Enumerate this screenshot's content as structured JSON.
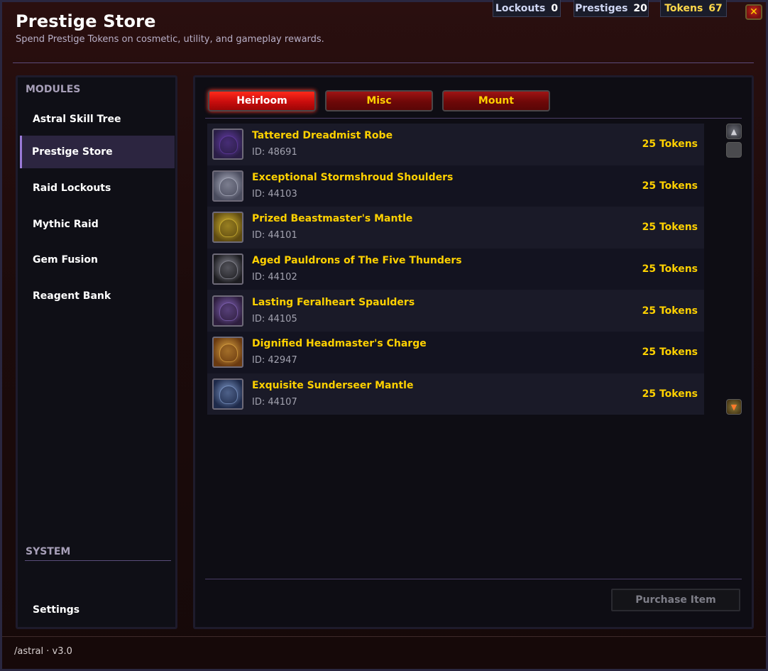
{
  "header": {
    "title": "Prestige Store",
    "subtitle": "Spend Prestige Tokens on cosmetic, utility, and gameplay rewards."
  },
  "counters": {
    "lockouts": {
      "label": "Lockouts",
      "value": "0"
    },
    "prestiges": {
      "label": "Prestiges",
      "value": "20"
    },
    "tokens": {
      "label": "Tokens",
      "value": "67"
    }
  },
  "close": {
    "glyph": "✕"
  },
  "sidebar": {
    "modules_label": "MODULES",
    "items": [
      {
        "label": "Astral Skill Tree"
      },
      {
        "label": "Prestige Store"
      },
      {
        "label": "Raid Lockouts"
      },
      {
        "label": "Mythic Raid"
      },
      {
        "label": "Gem Fusion"
      },
      {
        "label": "Reagent Bank"
      }
    ],
    "active_index": 1,
    "system_label": "SYSTEM",
    "settings_label": "Settings"
  },
  "tabs": [
    {
      "label": "Heirloom",
      "active": true
    },
    {
      "label": "Misc",
      "active": false
    },
    {
      "label": "Mount",
      "active": false
    }
  ],
  "items": [
    {
      "name": "Tattered Dreadmist Robe",
      "id": "ID: 48691",
      "price": "25 Tokens",
      "icon": "robe-icon",
      "colors": [
        "#2a1e46",
        "#6a3fb0"
      ]
    },
    {
      "name": "Exceptional Stormshroud Shoulders",
      "id": "ID: 44103",
      "price": "25 Tokens",
      "icon": "shoulders-icon",
      "colors": [
        "#4a4c5e",
        "#b9bccc"
      ]
    },
    {
      "name": "Prized Beastmaster's Mantle",
      "id": "ID: 44101",
      "price": "25 Tokens",
      "icon": "mantle-icon",
      "colors": [
        "#5e4a10",
        "#e2c338"
      ]
    },
    {
      "name": "Aged Pauldrons of The Five Thunders",
      "id": "ID: 44102",
      "price": "25 Tokens",
      "icon": "pauldrons-icon",
      "colors": [
        "#1c1c20",
        "#9a9aa6"
      ]
    },
    {
      "name": "Lasting Feralheart Spaulders",
      "id": "ID: 44105",
      "price": "25 Tokens",
      "icon": "spaulders-icon",
      "colors": [
        "#2e1e3e",
        "#8a6ac2"
      ]
    },
    {
      "name": "Dignified Headmaster's Charge",
      "id": "ID: 42947",
      "price": "25 Tokens",
      "icon": "staff-icon",
      "colors": [
        "#6a3a10",
        "#e8b04a"
      ]
    },
    {
      "name": "Exquisite Sunderseer Mantle",
      "id": "ID: 44107",
      "price": "25 Tokens",
      "icon": "mantle-blue-icon",
      "colors": [
        "#1e2a4a",
        "#8aa6d8"
      ]
    }
  ],
  "scroll": {
    "up_icon": "scroll-up-icon",
    "down_icon": "scroll-down-icon"
  },
  "purchase_label": "Purchase Item",
  "footer": {
    "text": "/astral · v3.0"
  }
}
